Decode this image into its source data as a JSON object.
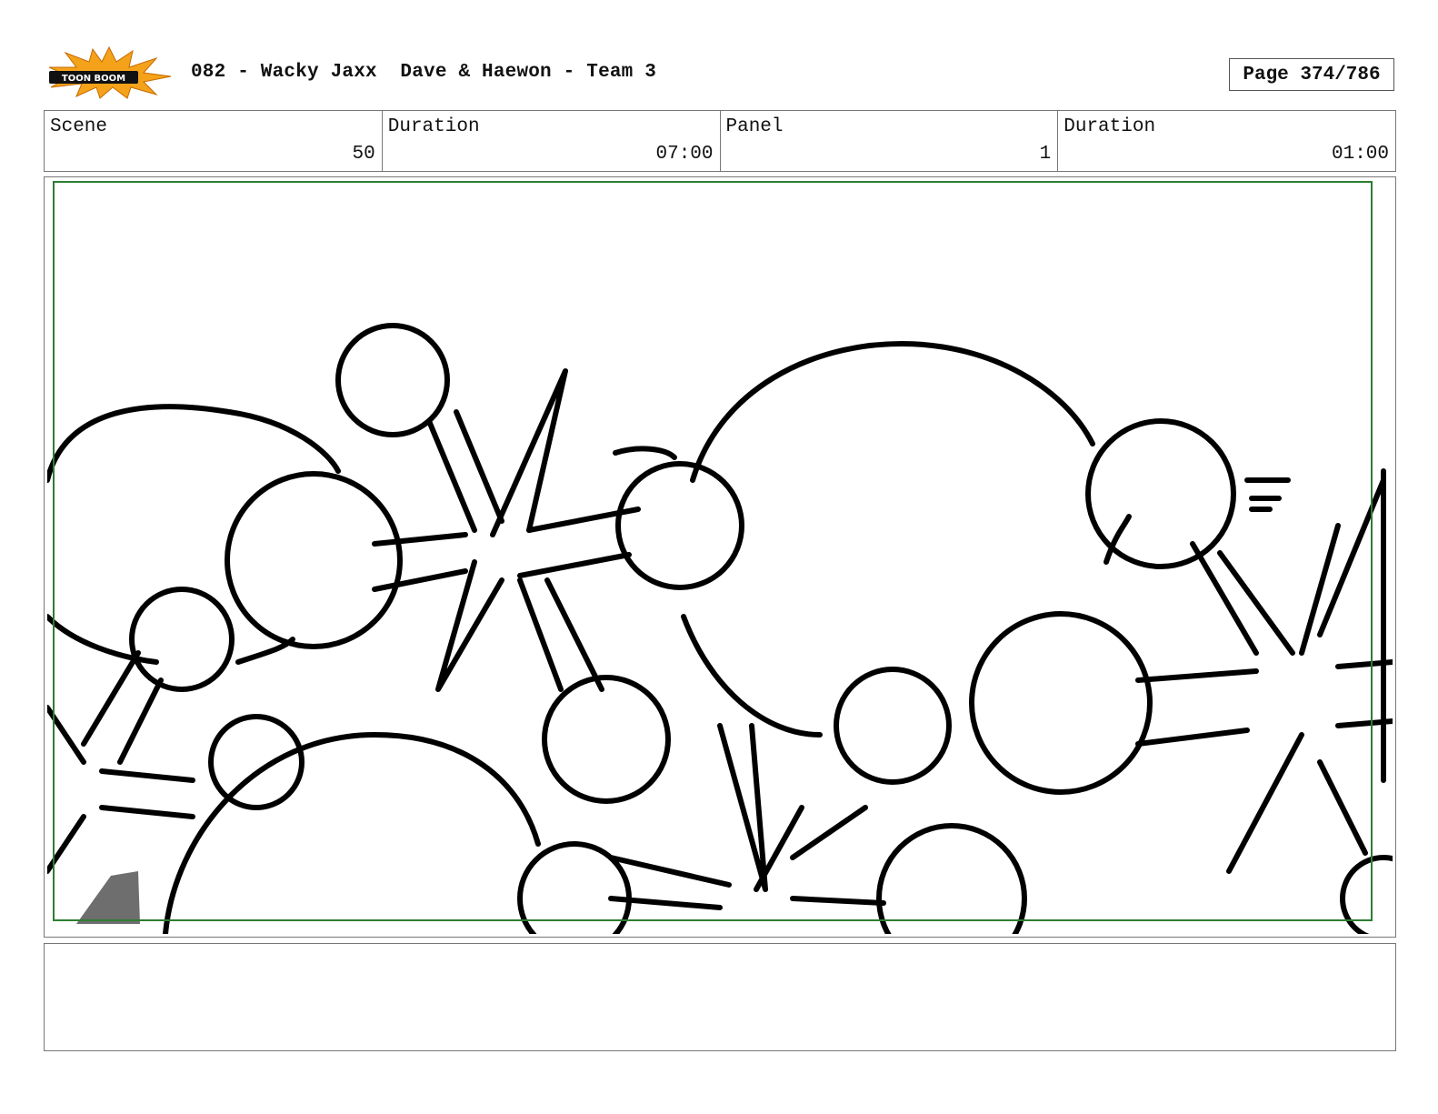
{
  "header": {
    "logo_text": "TOON BOOM",
    "title": "082 - Wacky Jaxx  Dave & Haewon - Team 3",
    "page": "Page 374/786"
  },
  "info": {
    "scene_label": "Scene",
    "scene_value": "50",
    "scene_duration_label": "Duration",
    "scene_duration_value": "07:00",
    "panel_label": "Panel",
    "panel_value": "1",
    "panel_duration_label": "Duration",
    "panel_duration_value": "01:00"
  },
  "colors": {
    "safe_frame": "#2e7d32",
    "line": "#000000",
    "logo_burst": "#f5a21b"
  },
  "notes": {
    "text": ""
  }
}
